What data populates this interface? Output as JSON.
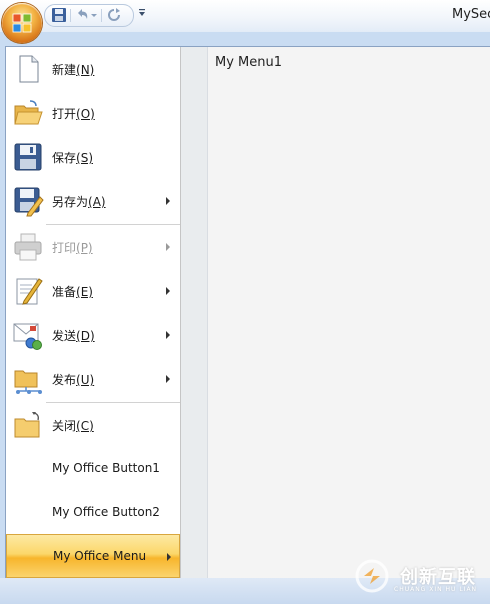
{
  "app": {
    "title": "MySec"
  },
  "quick_access": {
    "icons": [
      "save-icon",
      "undo-icon",
      "undo-dropdown-icon",
      "redo-icon",
      "customize-qat-icon"
    ]
  },
  "menu": {
    "items": [
      {
        "label": "新建(N)",
        "icon": "new-document-icon",
        "has_submenu": false,
        "enabled": true
      },
      {
        "label": "打开(O)",
        "icon": "open-folder-icon",
        "has_submenu": false,
        "enabled": true
      },
      {
        "label": "保存(S)",
        "icon": "save-disk-icon",
        "has_submenu": false,
        "enabled": true
      },
      {
        "label": "另存为(A)",
        "icon": "save-as-icon",
        "has_submenu": true,
        "enabled": true
      },
      {
        "label": "打印(P)",
        "icon": "print-icon",
        "has_submenu": true,
        "enabled": false
      },
      {
        "label": "准备(E)",
        "icon": "prepare-icon",
        "has_submenu": true,
        "enabled": true
      },
      {
        "label": "发送(D)",
        "icon": "send-icon",
        "has_submenu": true,
        "enabled": true
      },
      {
        "label": "发布(U)",
        "icon": "publish-icon",
        "has_submenu": true,
        "enabled": true
      },
      {
        "label": "关闭(C)",
        "icon": "close-folder-icon",
        "has_submenu": false,
        "enabled": true
      },
      {
        "label": "My Office Button1",
        "icon": "",
        "has_submenu": false,
        "enabled": true
      },
      {
        "label": "My Office Button2",
        "icon": "",
        "has_submenu": false,
        "enabled": true
      },
      {
        "label": "My Office Menu",
        "icon": "",
        "has_submenu": true,
        "enabled": true,
        "active": true
      }
    ]
  },
  "submenu": {
    "title": "My Menu1"
  },
  "watermark": {
    "text": "创新互联",
    "subtext": "CHUANG XIN HU LIAN"
  },
  "colors": {
    "highlight": "#f7b52c",
    "panel_border": "#8aa2c2",
    "orb": "#d9781b"
  }
}
